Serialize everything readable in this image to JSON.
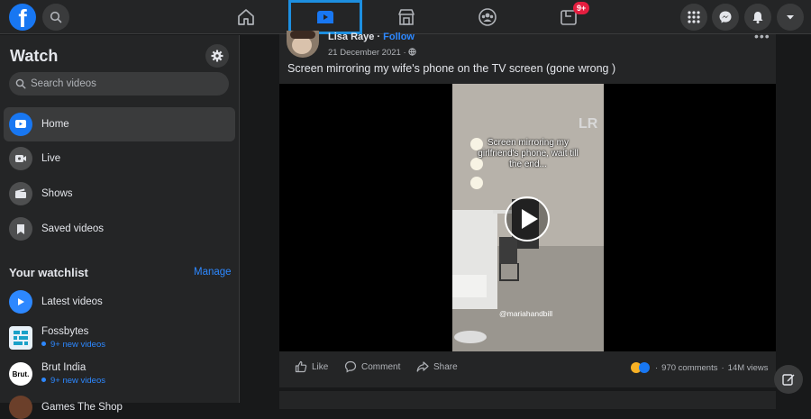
{
  "topbar": {
    "logo_letter": "f",
    "badge": "9+",
    "nav_tabs": [
      "home",
      "watch",
      "marketplace",
      "groups",
      "gaming"
    ]
  },
  "sidebar": {
    "title": "Watch",
    "search_placeholder": "Search videos",
    "items": [
      {
        "label": "Home",
        "icon": "watch-icon",
        "active": true
      },
      {
        "label": "Live",
        "icon": "live-icon"
      },
      {
        "label": "Shows",
        "icon": "shows-icon"
      },
      {
        "label": "Saved videos",
        "icon": "saved-icon"
      }
    ],
    "watchlist_title": "Your watchlist",
    "manage_label": "Manage",
    "watchlist": [
      {
        "name": "Latest videos",
        "sub": ""
      },
      {
        "name": "Fossbytes",
        "sub": "9+ new videos"
      },
      {
        "name": "Brut India",
        "sub": "9+ new videos",
        "thumb_text": "Brut."
      },
      {
        "name": "Games The Shop",
        "sub": ""
      }
    ]
  },
  "post": {
    "author": "Lisa Raye",
    "separator": " · ",
    "follow": "Follow",
    "date": "21 December 2021 ·",
    "caption": "Screen mirroring my wife's phone on the TV screen (gone wrong )",
    "video_overlay": "Screen mirroring my girlfriend's phone, wait till the end...",
    "video_handle": "@mariahandbill",
    "watermark": "LR",
    "like_label": "Like",
    "comment_label": "Comment",
    "share_label": "Share",
    "comments_count": "970 comments",
    "views": "14M views",
    "stats_separator": "·"
  },
  "colors": {
    "accent": "#1877f2",
    "link": "#2d88ff",
    "badge": "#e41e3f",
    "active_tab_border": "#1d8fe0"
  }
}
